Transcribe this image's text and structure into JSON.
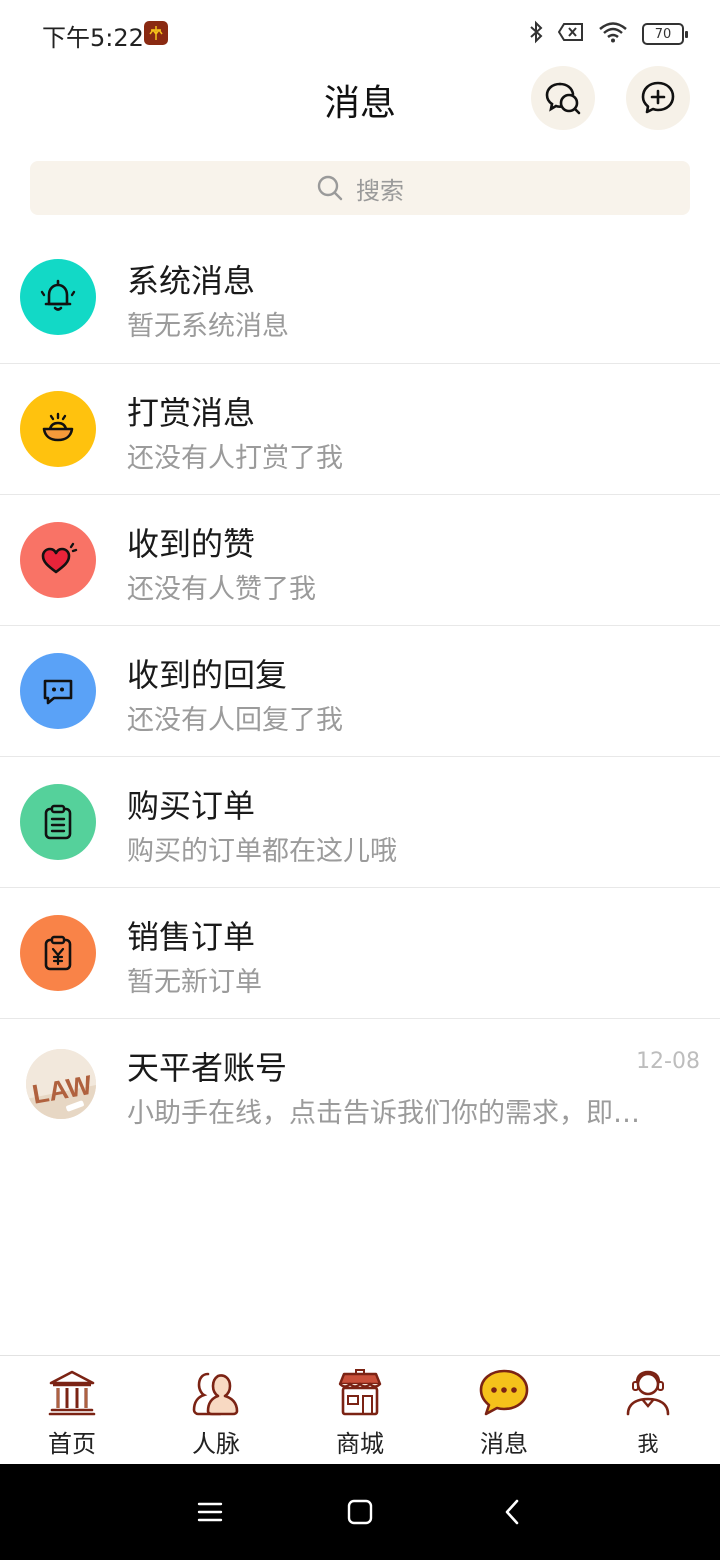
{
  "status_bar": {
    "time": "下午5:22",
    "battery": "70"
  },
  "header": {
    "title": "消息"
  },
  "search": {
    "placeholder": "搜索"
  },
  "messages": [
    {
      "title": "系统消息",
      "subtitle": "暂无系统消息",
      "icon": "bell-icon",
      "color": "#12d9c6"
    },
    {
      "title": "打赏消息",
      "subtitle": "还没有人打赏了我",
      "icon": "gold-ingot-icon",
      "color": "#ffc20e"
    },
    {
      "title": "收到的赞",
      "subtitle": "还没有人赞了我",
      "icon": "heart-icon",
      "color": "#f97366"
    },
    {
      "title": "收到的回复",
      "subtitle": "还没有人回复了我",
      "icon": "chat-bubble-icon",
      "color": "#5aa2f7"
    },
    {
      "title": "购买订单",
      "subtitle": "购买的订单都在这儿哦",
      "icon": "clipboard-icon",
      "color": "#55d19b"
    },
    {
      "title": "销售订单",
      "subtitle": "暂无新订单",
      "icon": "clipboard-yen-icon",
      "color": "#f98348"
    },
    {
      "title": "天平者账号",
      "subtitle": "小助手在线，点击告诉我们你的需求，即…",
      "time": "12-08",
      "icon": "law-avatar"
    }
  ],
  "tabs": [
    {
      "label": "首页",
      "icon": "courthouse-icon"
    },
    {
      "label": "人脉",
      "icon": "people-icon"
    },
    {
      "label": "商城",
      "icon": "shop-icon"
    },
    {
      "label": "消息",
      "icon": "message-icon",
      "active": true
    },
    {
      "label": "我",
      "icon": "profile-icon"
    }
  ],
  "colors": {
    "brand": "#8a2a12",
    "accent_yellow": "#f5c21b",
    "search_bg": "#f8f3eb"
  }
}
